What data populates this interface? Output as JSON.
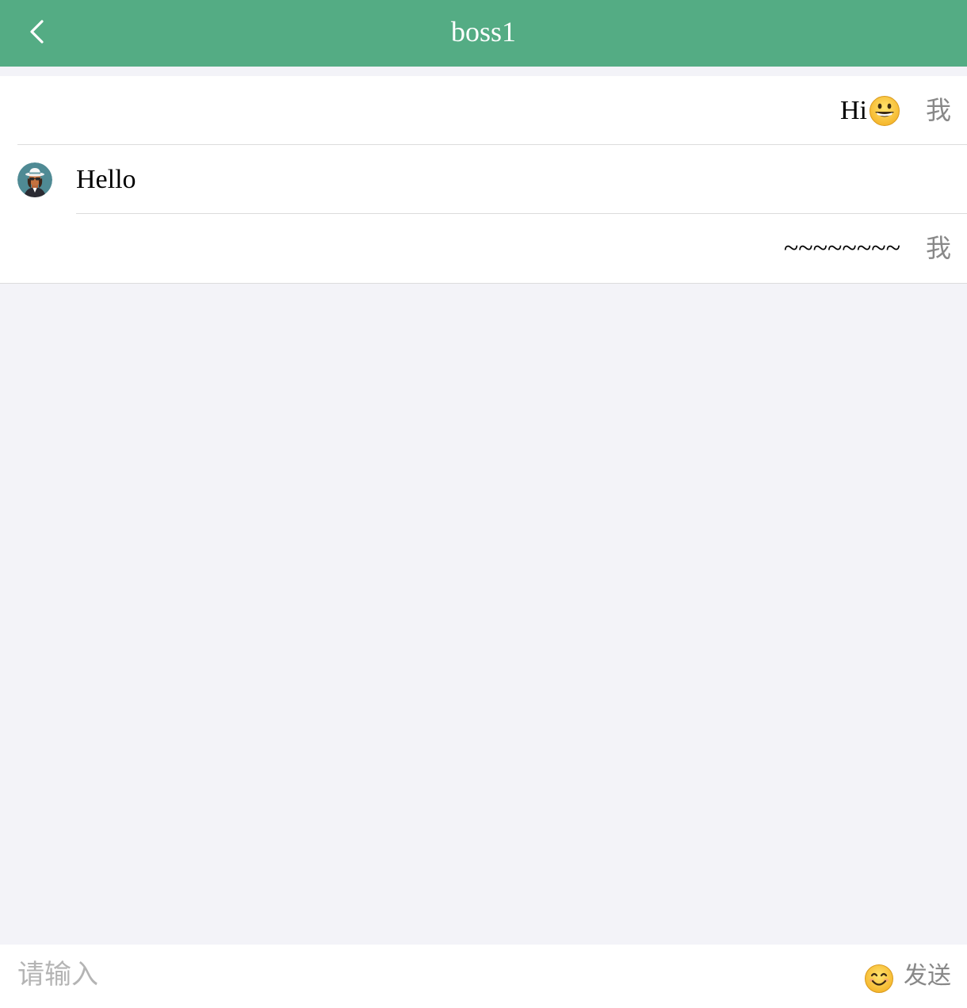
{
  "header": {
    "title": "boss1",
    "back_icon": "chevron-left-icon",
    "background_color": "#54ac84"
  },
  "messages": [
    {
      "sender": "me",
      "text": "Hi",
      "emoji": "grinning-face",
      "sender_label": "我"
    },
    {
      "sender": "other",
      "text": "Hello",
      "avatar": "avatar-person-icon"
    },
    {
      "sender": "me",
      "text": "~~~~~~~~",
      "sender_label": "我"
    }
  ],
  "input_bar": {
    "placeholder": "请输入",
    "emoji_icon": "smiling-face-icon",
    "send_label": "发送"
  }
}
